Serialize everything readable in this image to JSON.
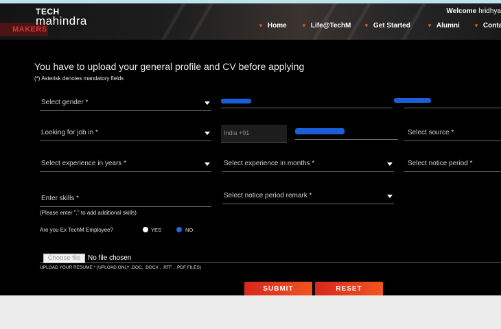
{
  "header": {
    "logo_top": "TECH",
    "logo_bottom": "mahindra",
    "badge": "MAKERS",
    "welcome_prefix": "Welcome",
    "welcome_user": "hridhya",
    "nav": [
      {
        "label": "Home"
      },
      {
        "label": "Life@TechM"
      },
      {
        "label": "Get Started"
      },
      {
        "label": "Alumni"
      },
      {
        "label": "Conta"
      }
    ]
  },
  "form": {
    "title": "You have to upload your general profile and CV before applying",
    "mandatory_note": "(*) Asterisk denotes mandatory fields",
    "gender_placeholder": "Select gender *",
    "job_location_placeholder": "Looking for job in *",
    "country_code": "India +91",
    "source_placeholder": "Select source *",
    "experience_years_placeholder": "Select experience in years *",
    "experience_months_placeholder": "Select experience in months *",
    "notice_period_placeholder": "Select notice period *",
    "skills_placeholder": "Enter skills *",
    "notice_remark_placeholder": "Select notice period remark *",
    "skills_hint": "(Please enter \",\" to add additional skills)",
    "ex_employee_question": "Are you Ex TechM Employee?",
    "yes_label": "YES",
    "no_label": "NO",
    "ex_employee_selected": "NO",
    "choose_file_label": "Choose file",
    "file_status": "No file chosen",
    "upload_note": "UPLOAD YOUR RESUME * (UPLOAD ONLY .DOC, .DOCX , .RTF , .PDF FILES)",
    "submit_label": "SUBMIT",
    "reset_label": "RESET"
  },
  "colors": {
    "accent": "#e85a1a",
    "radio_selected": "#1e63e0",
    "redaction": "#1a5fd9"
  }
}
